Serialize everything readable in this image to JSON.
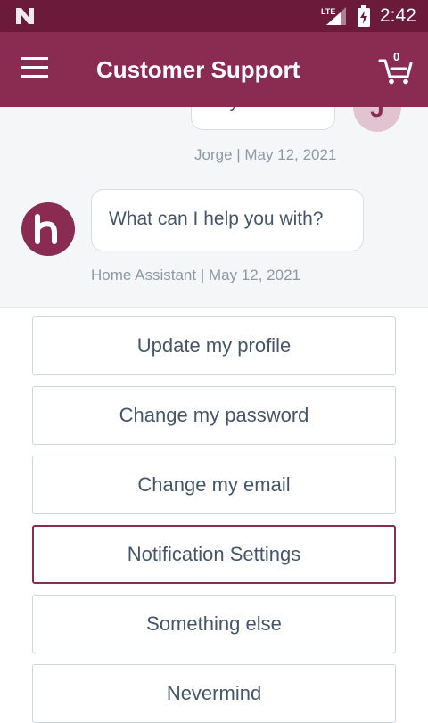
{
  "status_bar": {
    "network": "LTE",
    "time": "2:42"
  },
  "app_bar": {
    "title": "Customer Support",
    "cart_count": "0"
  },
  "chat": {
    "user_message": {
      "text": "My",
      "author": "Jorge",
      "date": "May 12, 2021",
      "meta": "Jorge | May 12, 2021",
      "avatar_initial": "J"
    },
    "bot_message": {
      "text": "What can I help you with?",
      "author": "Home Assistant",
      "date": "May 12, 2021",
      "meta": "Home Assistant | May 12, 2021"
    }
  },
  "options": [
    {
      "label": "Update my profile"
    },
    {
      "label": "Change my password"
    },
    {
      "label": "Change my email"
    },
    {
      "label": "Notification Settings"
    },
    {
      "label": "Something else"
    },
    {
      "label": "Nevermind"
    }
  ],
  "colors": {
    "status_bar": "#6b1a3a",
    "brand": "#8a2b52",
    "chat_background": "#f4f6f8",
    "text": "#45566a",
    "meta_text": "#8d9aa6"
  }
}
